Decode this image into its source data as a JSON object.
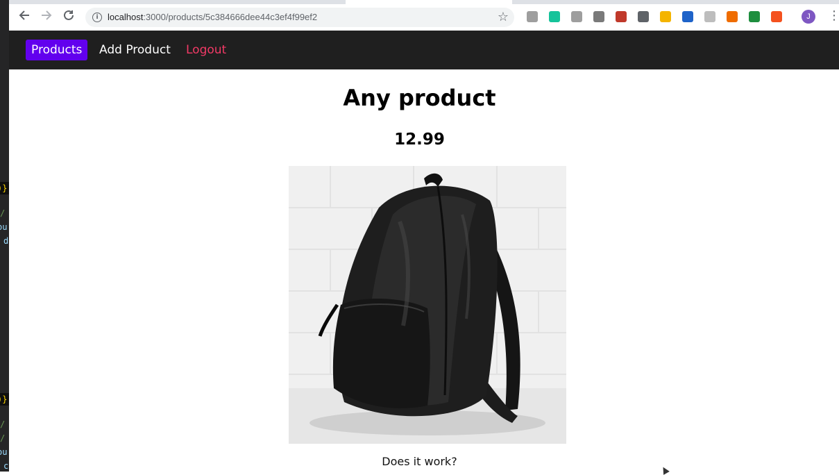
{
  "browser": {
    "url_host": "localhost",
    "url_path": ":3000/products/5c384666dee44c3ef4f99ef2",
    "profile_initial": "J",
    "extensions": [
      {
        "icon": "ext-icon-1",
        "color": "#9e9e9e"
      },
      {
        "icon": "grammarly-icon",
        "color": "#15c39a"
      },
      {
        "icon": "ext-icon-3",
        "color": "#9e9e9e"
      },
      {
        "icon": "vue-devtools-icon",
        "color": "#7a7a7a"
      },
      {
        "icon": "ext-icon-5",
        "color": "#c0392b"
      },
      {
        "icon": "ext-icon-6",
        "color": "#5f6368"
      },
      {
        "icon": "ext-icon-7",
        "color": "#f4b400"
      },
      {
        "icon": "movistar-icon",
        "color": "#1e63c9"
      },
      {
        "icon": "ext-icon-9",
        "color": "#bdbdbd"
      },
      {
        "icon": "ext-icon-10",
        "color": "#ef6c00"
      },
      {
        "icon": "ext-icon-11",
        "color": "#1e8e3e"
      },
      {
        "icon": "ext-icon-12",
        "color": "#f4511e"
      }
    ]
  },
  "nav": {
    "products": "Products",
    "add_product": "Add Product",
    "logout": "Logout"
  },
  "product": {
    "title": "Any product",
    "price": "12.99",
    "description": "Does it work?"
  },
  "editor_fragments": [
    ")};",
    "/",
    "ou",
    "d",
    ")};",
    "/",
    "/",
    "ou",
    "c"
  ],
  "colors": {
    "header_bg": "#1f1f1f",
    "active_link_bg": "#6200ee",
    "logout_color": "#f23a66"
  }
}
